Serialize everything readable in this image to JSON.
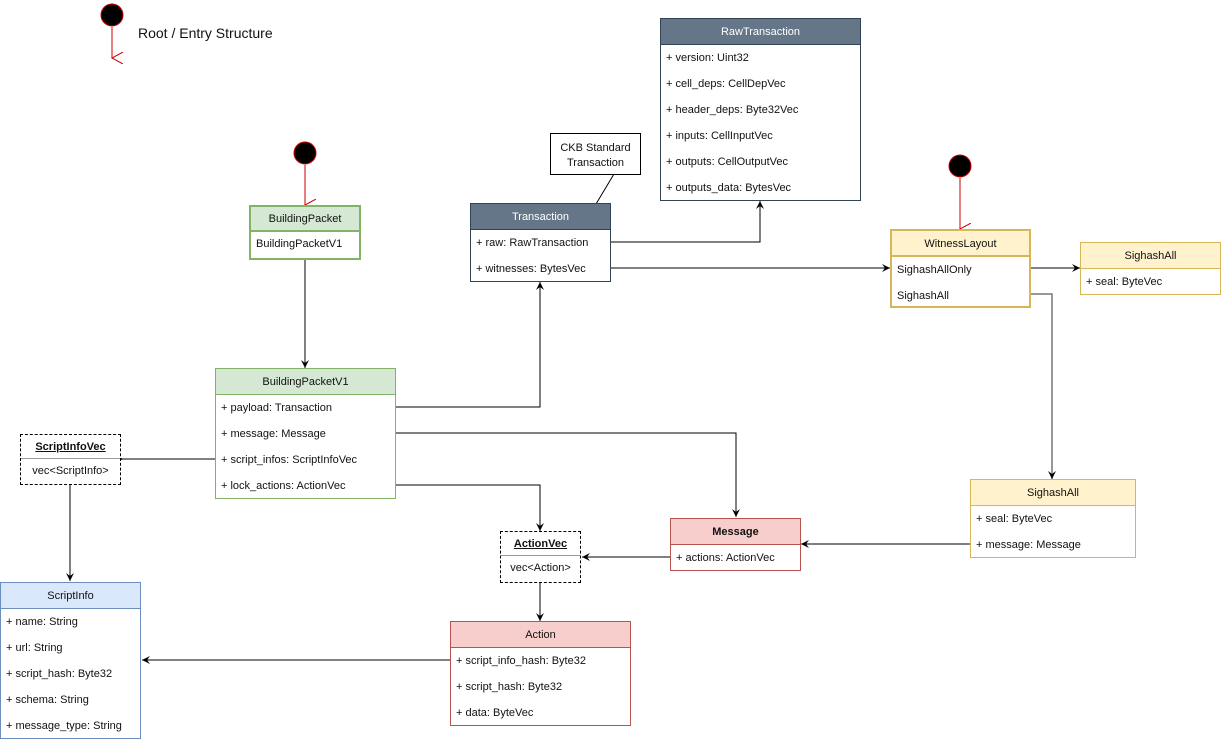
{
  "legend": {
    "label": "Root / Entry Structure",
    "icon": "initial-state-dot"
  },
  "note": {
    "line1": "CKB Standard",
    "line2": "Transaction"
  },
  "colors": {
    "dark_header": "#647687",
    "green_header": "#d5e8d4",
    "yellow_header": "#fff2cc",
    "red_header": "#f8cecc",
    "blue_header": "#dae8fc",
    "root_arrow": "#cc0000"
  },
  "boxes": {
    "raw_transaction": {
      "title": "RawTransaction",
      "fields": [
        "+ version: Uint32",
        "+ cell_deps: CellDepVec",
        "+ header_deps: Byte32Vec",
        "+ inputs: CellInputVec",
        "+ outputs: CellOutputVec",
        "+ outputs_data: BytesVec"
      ]
    },
    "transaction": {
      "title": "Transaction",
      "fields": [
        "+ raw: RawTransaction",
        "+ witnesses: BytesVec"
      ]
    },
    "building_packet": {
      "title": "BuildingPacket",
      "fields": [
        "BuildingPacketV1"
      ]
    },
    "building_packet_v1": {
      "title": "BuildingPacketV1",
      "fields": [
        "+ payload: Transaction",
        "+ message: Message",
        "+ script_infos: ScriptInfoVec",
        "+ lock_actions: ActionVec"
      ]
    },
    "witness_layout": {
      "title": "WitnessLayout",
      "fields": [
        "SighashAllOnly",
        "SighashAll"
      ]
    },
    "sighash_all_only": {
      "title": "SighashAll",
      "fields": [
        "+ seal: ByteVec"
      ]
    },
    "sighash_all": {
      "title": "SighashAll",
      "fields": [
        "+ seal: ByteVec",
        "+ message: Message"
      ]
    },
    "script_info_vec": {
      "title": "ScriptInfoVec",
      "fields": [
        "vec<ScriptInfo>"
      ]
    },
    "script_info": {
      "title": "ScriptInfo",
      "fields": [
        "+ name: String",
        "+ url: String",
        "+ script_hash: Byte32",
        "+ schema: String",
        "+ message_type: String"
      ]
    },
    "message": {
      "title": "Message",
      "fields": [
        "+ actions: ActionVec"
      ]
    },
    "action_vec": {
      "title": "ActionVec",
      "fields": [
        "vec<Action>"
      ]
    },
    "action": {
      "title": "Action",
      "fields": [
        "+ script_info_hash: Byte32",
        "+ script_hash: Byte32",
        "+ data: ByteVec"
      ]
    }
  }
}
